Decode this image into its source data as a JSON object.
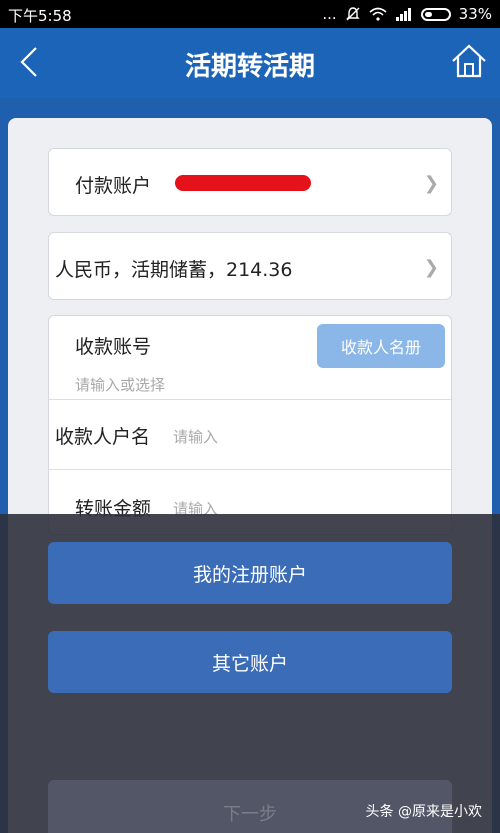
{
  "status_bar": {
    "time": "下午5:58",
    "signal_dots": "...",
    "battery_percent": "33%"
  },
  "nav": {
    "title": "活期转活期"
  },
  "form": {
    "payer_account_label": "付款账户",
    "account_summary": "人民币，活期储蓄，214.36",
    "payee_account_label": "收款账号",
    "payee_account_placeholder": "请输入或选择",
    "payee_book_button": "收款人名册",
    "payee_name_label": "收款人户名",
    "payee_name_placeholder": "请输入",
    "amount_label": "转账金额",
    "amount_placeholder": "请输入"
  },
  "sheet": {
    "option_1": "我的注册账户",
    "option_2": "其它账户",
    "next_label": "下一步"
  },
  "watermark": "头条 @原来是小欢",
  "colors": {
    "nav_blue": "#1c64b8",
    "button_blue": "#3b6cb8",
    "payee_button": "#8ab7e7",
    "redaction": "#e6121b"
  }
}
